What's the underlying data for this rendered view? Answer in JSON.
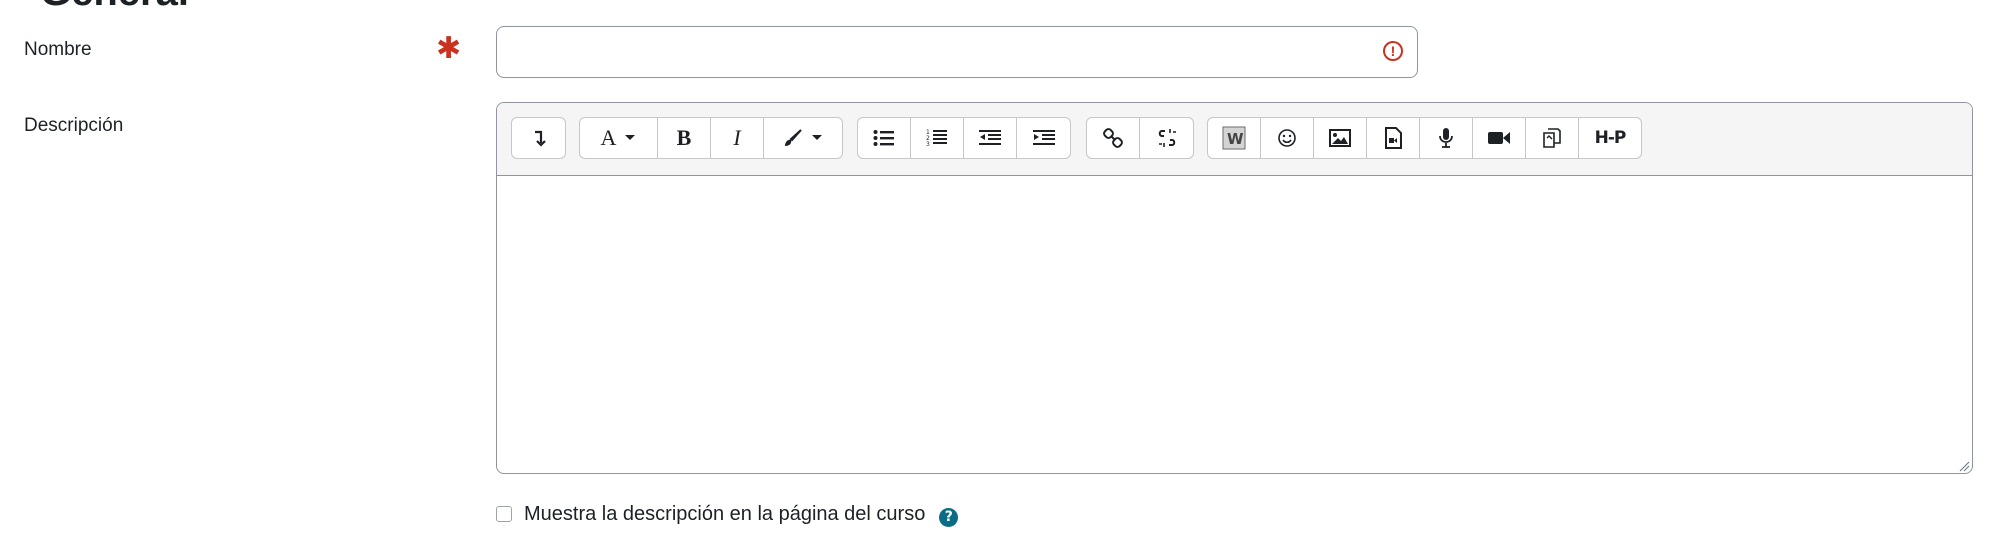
{
  "section": {
    "title": "General"
  },
  "form": {
    "name_label": "Nombre",
    "name_value": "",
    "required_symbol": "✱",
    "description_label": "Descripción",
    "show_description_label": "Muestra la descripción en la página del curso",
    "show_description_checked": false
  },
  "toolbar": {
    "groups": [
      [
        "collapse-icon"
      ],
      [
        "font-style-dropdown",
        "bold-icon",
        "italic-icon",
        "paint-brush-dropdown"
      ],
      [
        "unordered-list-icon",
        "ordered-list-icon",
        "outdent-icon",
        "indent-icon"
      ],
      [
        "link-icon",
        "unlink-icon"
      ],
      [
        "word-import-icon",
        "emoji-icon",
        "image-icon",
        "media-icon",
        "record-audio-icon",
        "record-video-icon",
        "manage-files-icon",
        "h5p-icon"
      ]
    ],
    "font_style_label": "A",
    "bold_label": "B",
    "italic_label": "I",
    "h5p_label": "H-P"
  },
  "colors": {
    "required": "#ca3120",
    "help": "#0b6d85",
    "border": "#8f959e"
  }
}
